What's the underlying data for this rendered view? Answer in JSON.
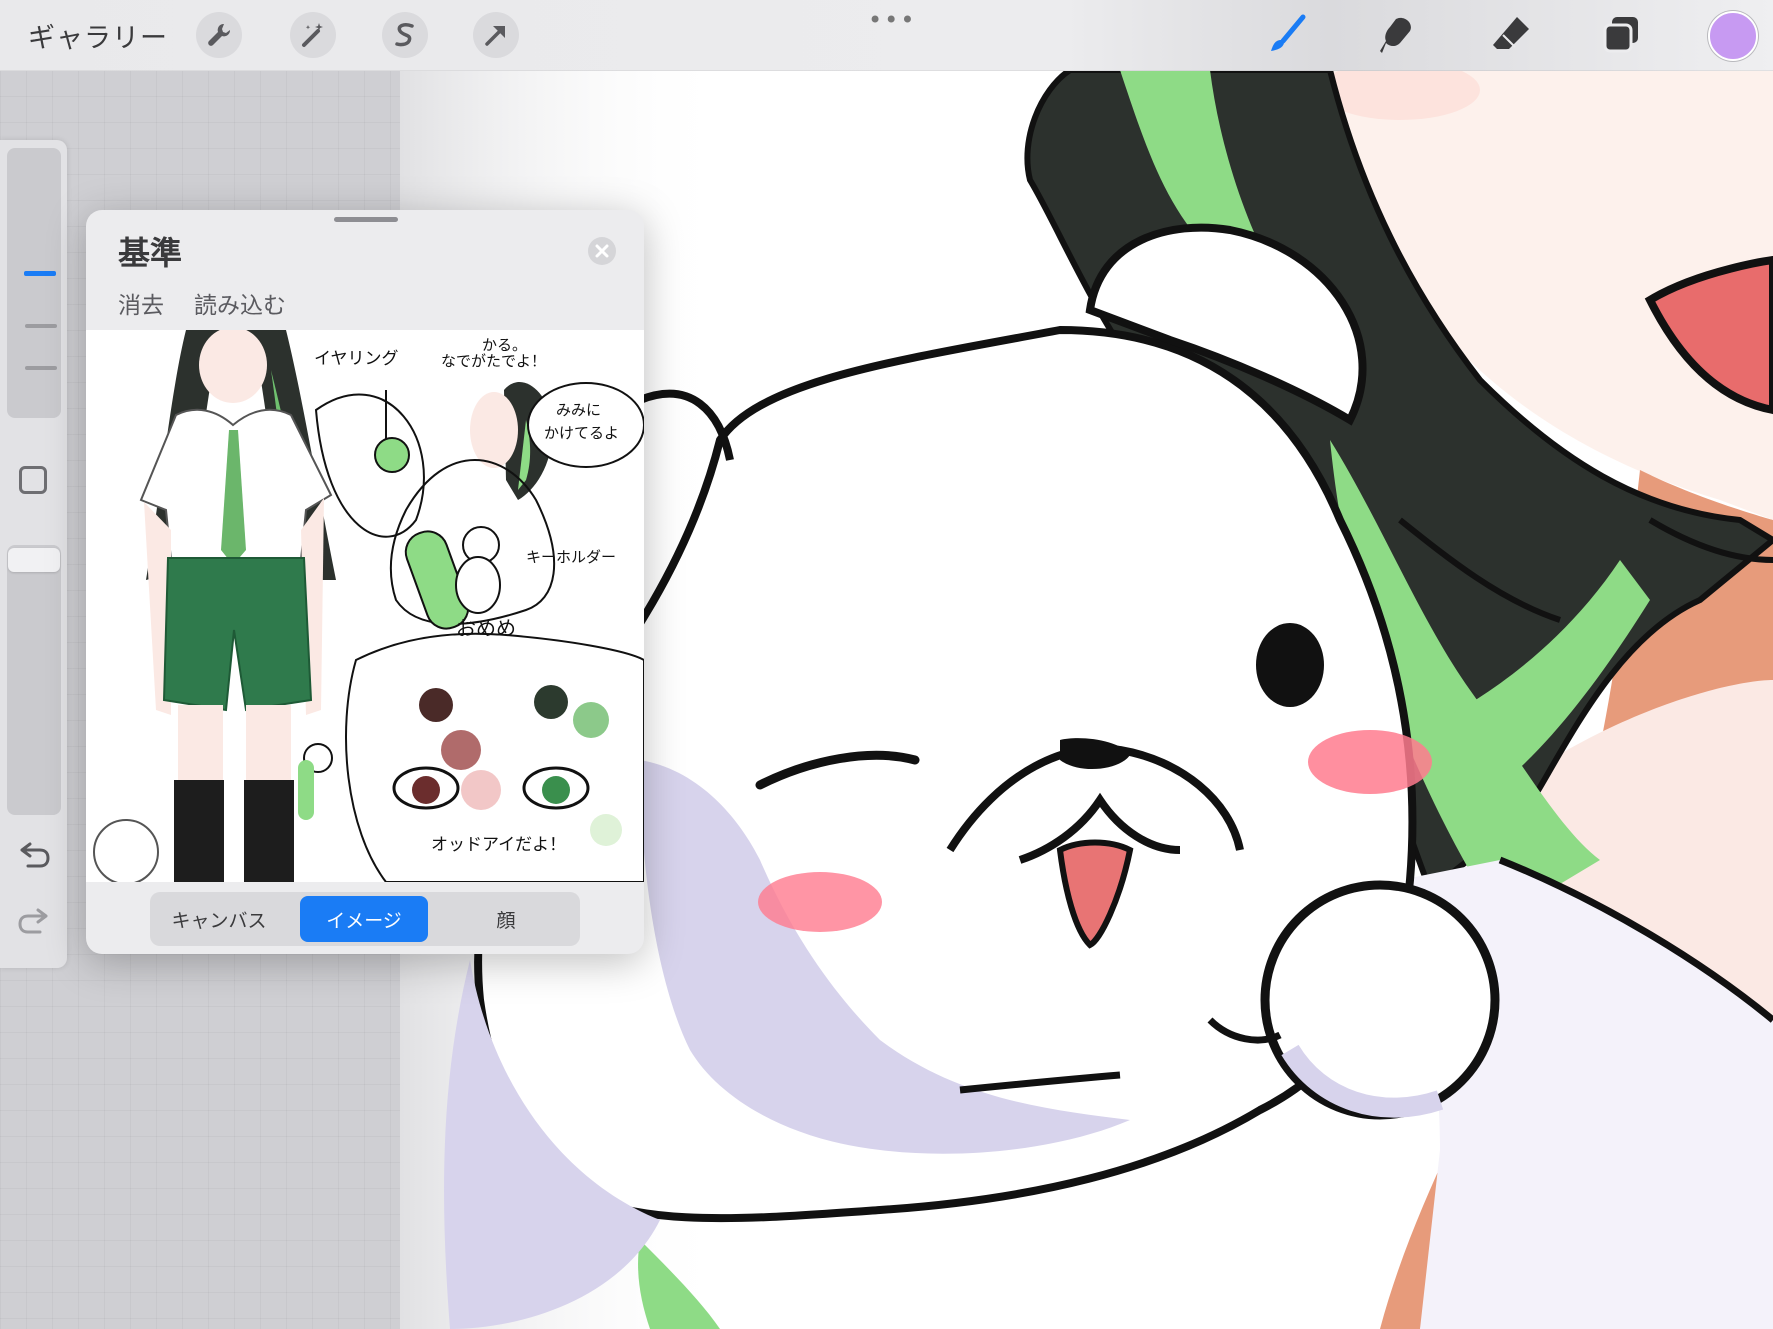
{
  "toolbar": {
    "gallery_label": "ギャラリー",
    "left_tools": [
      {
        "name": "actions",
        "icon": "wrench-icon"
      },
      {
        "name": "adjustments",
        "icon": "magic-wand-icon"
      },
      {
        "name": "selection",
        "icon": "selection-s-icon"
      },
      {
        "name": "transform",
        "icon": "arrow-cursor-icon"
      }
    ],
    "more_label": "•••",
    "right_tools": [
      {
        "name": "brush",
        "icon": "brush-icon",
        "active": true
      },
      {
        "name": "smudge",
        "icon": "smudge-finger-icon"
      },
      {
        "name": "eraser",
        "icon": "eraser-icon"
      },
      {
        "name": "layers",
        "icon": "layers-icon"
      }
    ],
    "current_color": "#c79af2",
    "accent_color": "#1a7cf5"
  },
  "sidebar": {
    "brush_size_level": 0.55,
    "opacity_level": 0.95,
    "modify_icon": "square-icon",
    "undo_icon": "undo-icon",
    "redo_icon": "redo-icon"
  },
  "reference_panel": {
    "title": "基準",
    "clear_label": "消去",
    "import_label": "読み込む",
    "tabs": [
      {
        "label": "キャンバス",
        "selected": false
      },
      {
        "label": "イメージ",
        "selected": true
      },
      {
        "label": "顔",
        "selected": false
      }
    ],
    "image_annotations": {
      "earring": "イヤリング",
      "cherry_note": "なでがたでよ！",
      "ear_note_1": "みみに",
      "ear_note_2": "かけてるよ",
      "keyholder": "キーホルダー",
      "eye_title": "おめめ",
      "odd_eye": "オッドアイだよ！",
      "top_fragment": "かる。"
    }
  }
}
